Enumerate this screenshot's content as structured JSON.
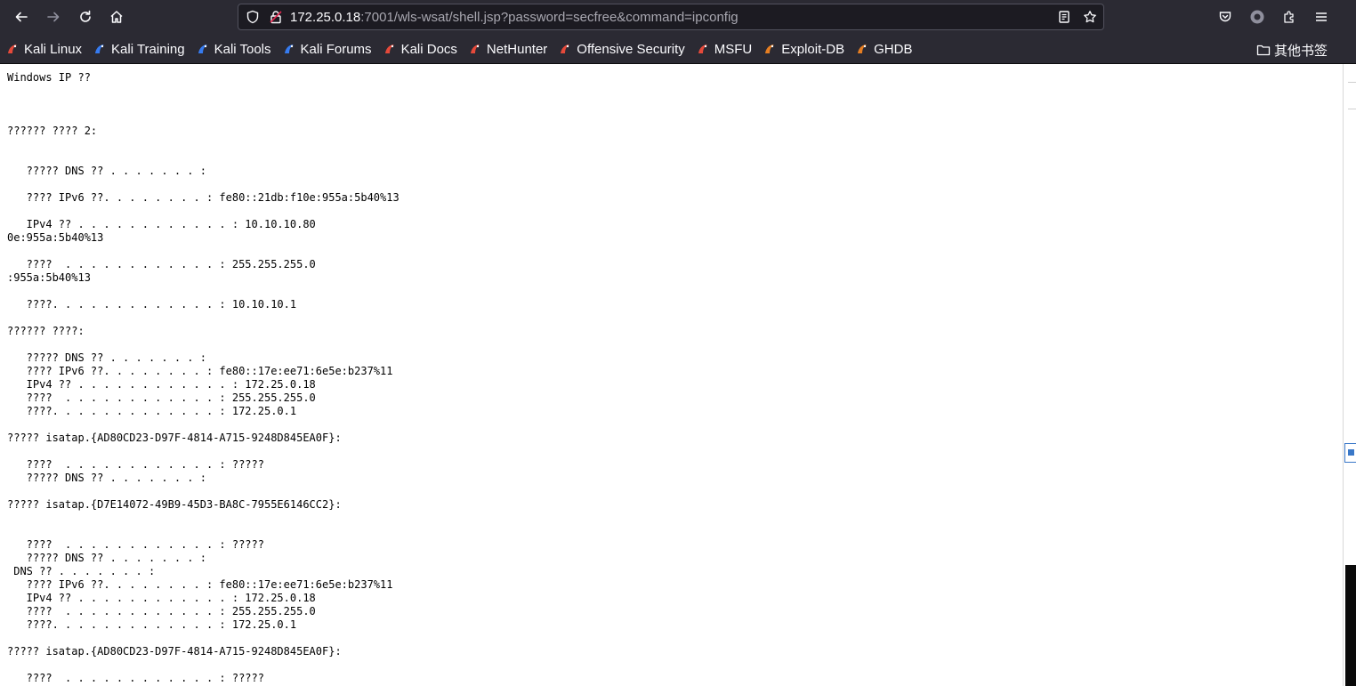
{
  "browser": {
    "url_host": "172.25.0.18",
    "url_rest": ":7001/wls-wsat/shell.jsp?password=secfree&command=ipconfig",
    "bookmarks": [
      {
        "label": "Kali Linux",
        "icon": "kali-dragon-icon",
        "color": "#e5493a"
      },
      {
        "label": "Kali Training",
        "icon": "kali-training-icon",
        "color": "#367bf0"
      },
      {
        "label": "Kali Tools",
        "icon": "kali-tools-icon",
        "color": "#367bf0"
      },
      {
        "label": "Kali Forums",
        "icon": "kali-forums-icon",
        "color": "#367bf0"
      },
      {
        "label": "Kali Docs",
        "icon": "kali-docs-icon",
        "color": "#e5493a"
      },
      {
        "label": "NetHunter",
        "icon": "nethunter-icon",
        "color": "#e5493a"
      },
      {
        "label": "Offensive Security",
        "icon": "offsec-icon",
        "color": "#e5493a"
      },
      {
        "label": "MSFU",
        "icon": "msfu-icon",
        "color": "#e5493a"
      },
      {
        "label": "Exploit-DB",
        "icon": "exploit-db-icon",
        "color": "#e67e22"
      },
      {
        "label": "GHDB",
        "icon": "ghdb-icon",
        "color": "#e67e22"
      }
    ],
    "other_bookmarks": "其他书签"
  },
  "page": {
    "output_lines": [
      "Windows IP ??",
      "",
      "",
      "",
      "?????? ???? 2:",
      "",
      "",
      "   ????? DNS ?? . . . . . . . :",
      "",
      "   ???? IPv6 ??. . . . . . . . : fe80::21db:f10e:955a:5b40%13",
      "",
      "   IPv4 ?? . . . . . . . . . . . . : 10.10.10.80",
      "0e:955a:5b40%13",
      "",
      "   ????  . . . . . . . . . . . . : 255.255.255.0",
      ":955a:5b40%13",
      "",
      "   ????. . . . . . . . . . . . . : 10.10.10.1",
      "",
      "?????? ????:",
      "",
      "   ????? DNS ?? . . . . . . . :",
      "   ???? IPv6 ??. . . . . . . . : fe80::17e:ee71:6e5e:b237%11",
      "   IPv4 ?? . . . . . . . . . . . . : 172.25.0.18",
      "   ????  . . . . . . . . . . . . : 255.255.255.0",
      "   ????. . . . . . . . . . . . . : 172.25.0.1",
      "",
      "????? isatap.{AD80CD23-D97F-4814-A715-9248D845EA0F}:",
      "",
      "   ????  . . . . . . . . . . . . : ?????",
      "   ????? DNS ?? . . . . . . . :",
      "",
      "????? isatap.{D7E14072-49B9-45D3-BA8C-7955E6146CC2}:",
      "",
      "",
      "   ????  . . . . . . . . . . . . : ?????",
      "   ????? DNS ?? . . . . . . . :",
      " DNS ?? . . . . . . . :",
      "   ???? IPv6 ??. . . . . . . . : fe80::17e:ee71:6e5e:b237%11",
      "   IPv4 ?? . . . . . . . . . . . . : 172.25.0.18",
      "   ????  . . . . . . . . . . . . : 255.255.255.0",
      "   ????. . . . . . . . . . . . . : 172.25.0.1",
      "",
      "????? isatap.{AD80CD23-D97F-4814-A715-9248D845EA0F}:",
      "",
      "   ????  . . . . . . . . . . . . : ?????"
    ]
  }
}
